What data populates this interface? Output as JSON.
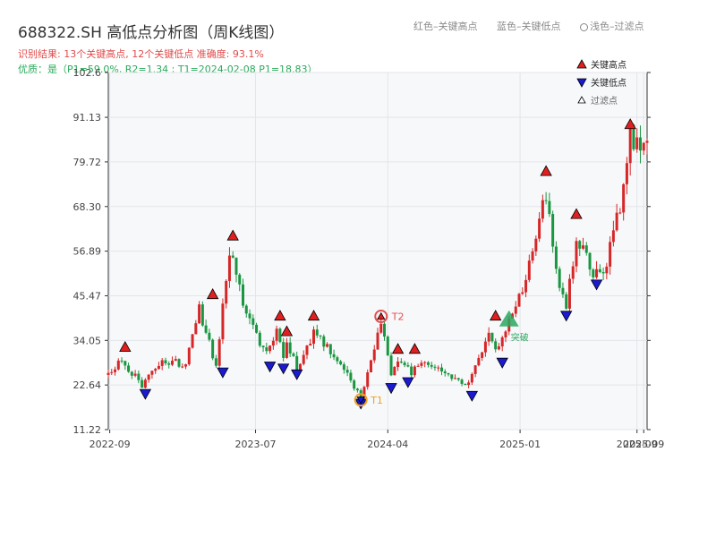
{
  "header": {
    "title": "688322.SH 高低点分析图（周K线图）",
    "subtitle_result": "识别结果: 13个关键高点, 12个关键低点  准确度: 93.1%",
    "subtitle_quality": "优质：是（P1=59.0%, R2=1.34 ; T1=2024-02-08 P1=18.83）"
  },
  "top_legend": {
    "high": "红色–关键高点",
    "low": "蓝色–关键低点",
    "filtered": "浅色–过滤点"
  },
  "colors": {
    "up": "#d62728",
    "down": "#1a9641",
    "high_marker": "#e02020",
    "low_marker": "#1a1ad0",
    "t1": "#f0a020",
    "t2": "#e05050",
    "breakout": "#2ca860",
    "plot_bg": "#f7f8fa"
  },
  "chart_data": {
    "type": "candlestick",
    "ylim": [
      11.22,
      102.6
    ],
    "yticks": [
      11.22,
      22.64,
      34.05,
      45.47,
      56.89,
      68.3,
      79.72,
      91.13,
      102.6
    ],
    "ytick_labels": [
      "11.22",
      "22.64",
      "34.05",
      "45.47",
      "56.89",
      "68.30",
      "79.72",
      "91.13",
      "102.6"
    ],
    "xlim": [
      "2022-08-29",
      "2025-09-22"
    ],
    "xticks": [
      {
        "date": "2022-09-01",
        "label": "2022-09"
      },
      {
        "date": "2023-07-01",
        "label": "2023-07"
      },
      {
        "date": "2024-04-01",
        "label": "2024-04"
      },
      {
        "date": "2025-01-01",
        "label": "2025-01"
      },
      {
        "date": "2025-09-01",
        "label": "2025-09"
      },
      {
        "date": "2025-09-15",
        "label": "2025-09"
      }
    ],
    "anchor_series": [
      {
        "date": "2022-08-29",
        "close": 25.0
      },
      {
        "date": "2022-09-26",
        "close": 29.0
      },
      {
        "date": "2022-11-07",
        "close": 22.5
      },
      {
        "date": "2022-12-19",
        "close": 29.0
      },
      {
        "date": "2023-02-06",
        "close": 28.0
      },
      {
        "date": "2023-03-06",
        "close": 42.0
      },
      {
        "date": "2023-04-10",
        "close": 27.5
      },
      {
        "date": "2023-05-08",
        "close": 57.0
      },
      {
        "date": "2023-06-12",
        "close": 40.0
      },
      {
        "date": "2023-07-24",
        "close": 30.5
      },
      {
        "date": "2023-08-14",
        "close": 37.0
      },
      {
        "date": "2023-08-28",
        "close": 29.0
      },
      {
        "date": "2023-09-04",
        "close": 33.5
      },
      {
        "date": "2023-09-25",
        "close": 27.0
      },
      {
        "date": "2023-10-30",
        "close": 36.0
      },
      {
        "date": "2023-12-25",
        "close": 28.0
      },
      {
        "date": "2024-02-05",
        "close": 19.5
      },
      {
        "date": "2024-03-18",
        "close": 38.5
      },
      {
        "date": "2024-04-08",
        "close": 25.0
      },
      {
        "date": "2024-04-22",
        "close": 29.0
      },
      {
        "date": "2024-05-20",
        "close": 26.0
      },
      {
        "date": "2024-06-10",
        "close": 28.5
      },
      {
        "date": "2024-08-05",
        "close": 25.0
      },
      {
        "date": "2024-09-16",
        "close": 22.5
      },
      {
        "date": "2024-10-28",
        "close": 36.0
      },
      {
        "date": "2024-11-11",
        "close": 31.0
      },
      {
        "date": "2024-12-09",
        "close": 39.0
      },
      {
        "date": "2025-01-13",
        "close": 50.0
      },
      {
        "date": "2025-02-24",
        "close": 72.0
      },
      {
        "date": "2025-03-24",
        "close": 48.0
      },
      {
        "date": "2025-04-07",
        "close": 42.5
      },
      {
        "date": "2025-04-28",
        "close": 61.0
      },
      {
        "date": "2025-06-02",
        "close": 52.0
      },
      {
        "date": "2025-06-23",
        "close": 51.0
      },
      {
        "date": "2025-08-04",
        "close": 72.0
      },
      {
        "date": "2025-08-18",
        "close": 87.0
      },
      {
        "date": "2025-09-01",
        "close": 84.0
      },
      {
        "date": "2025-09-22",
        "close": 87.0
      }
    ],
    "key_highs": [
      {
        "date": "2022-10-03",
        "value": 30.5
      },
      {
        "date": "2023-04-03",
        "value": 44.0
      },
      {
        "date": "2023-05-15",
        "value": 59.0
      },
      {
        "date": "2023-08-21",
        "value": 38.5
      },
      {
        "date": "2023-09-04",
        "value": 34.5
      },
      {
        "date": "2023-10-30",
        "value": 38.5
      },
      {
        "date": "2024-04-22",
        "value": 30.0
      },
      {
        "date": "2024-05-27",
        "value": 30.0
      },
      {
        "date": "2024-11-11",
        "value": 38.5
      },
      {
        "date": "2025-02-24",
        "value": 75.5
      },
      {
        "date": "2025-04-28",
        "value": 64.5
      },
      {
        "date": "2025-08-18",
        "value": 87.5
      }
    ],
    "key_lows": [
      {
        "date": "2022-11-14",
        "value": 22.0
      },
      {
        "date": "2023-04-24",
        "value": 27.5
      },
      {
        "date": "2023-07-31",
        "value": 29.0
      },
      {
        "date": "2023-08-28",
        "value": 28.5
      },
      {
        "date": "2023-09-25",
        "value": 27.0
      },
      {
        "date": "2024-02-05",
        "value": 19.5
      },
      {
        "date": "2024-04-08",
        "value": 23.5
      },
      {
        "date": "2024-05-13",
        "value": 25.0
      },
      {
        "date": "2024-09-23",
        "value": 21.5
      },
      {
        "date": "2024-11-25",
        "value": 30.0
      },
      {
        "date": "2025-04-07",
        "value": 42.0
      },
      {
        "date": "2025-06-09",
        "value": 50.0
      }
    ],
    "t1": {
      "label": "T1",
      "date": "2024-02-05",
      "value": 18.83
    },
    "t2": {
      "label": "T2",
      "date": "2024-03-18",
      "value": 39.5
    },
    "breakout": {
      "label": "突破",
      "date": "2024-12-09",
      "value": 39.0
    },
    "legend": [
      {
        "label": "关键高点",
        "kind": "high"
      },
      {
        "label": "关键低点",
        "kind": "low"
      },
      {
        "label": "过滤点",
        "kind": "filtered"
      }
    ]
  }
}
